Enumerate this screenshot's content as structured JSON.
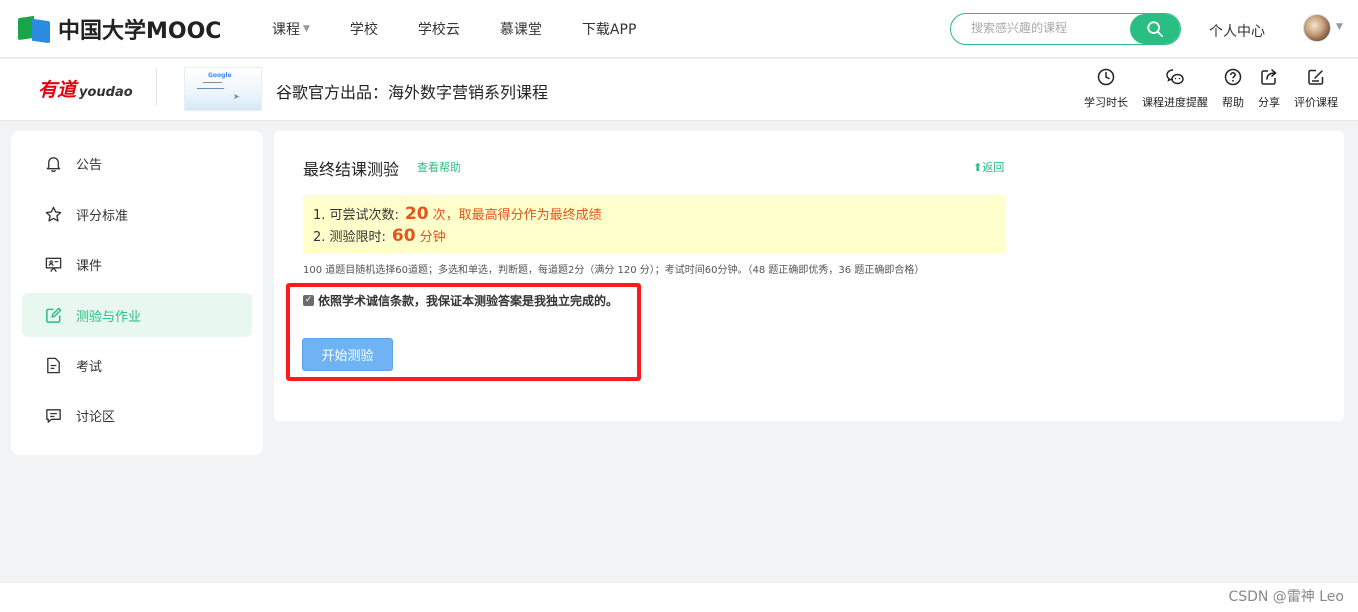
{
  "brand": {
    "logo_text": "中国大学MOOC"
  },
  "nav": {
    "items": [
      {
        "label": "课程",
        "has_caret": true
      },
      {
        "label": "学校"
      },
      {
        "label": "学校云"
      },
      {
        "label": "慕课堂"
      },
      {
        "label": "下载APP"
      }
    ],
    "search_placeholder": "搜索感兴趣的课程",
    "personal_center": "个人中心"
  },
  "course": {
    "partner_logo_cn": "有道",
    "partner_logo_en": "youdao",
    "thumb_brand": "Google",
    "title": "谷歌官方出品：海外数字营销系列课程",
    "tools": [
      {
        "label": "学习时长",
        "icon": "clock-icon"
      },
      {
        "label": "课程进度提醒",
        "icon": "wechat-icon"
      },
      {
        "label": "帮助",
        "icon": "help-icon"
      },
      {
        "label": "分享",
        "icon": "share-icon"
      },
      {
        "label": "评价课程",
        "icon": "review-icon"
      }
    ]
  },
  "sidebar": {
    "items": [
      {
        "label": "公告",
        "icon": "bell-icon"
      },
      {
        "label": "评分标准",
        "icon": "star-icon"
      },
      {
        "label": "课件",
        "icon": "courseware-icon"
      },
      {
        "label": "测验与作业",
        "icon": "edit-icon",
        "active": true
      },
      {
        "label": "考试",
        "icon": "document-icon"
      },
      {
        "label": "讨论区",
        "icon": "chat-icon"
      }
    ]
  },
  "quiz": {
    "title": "最终结课测验",
    "help_link": "查看帮助",
    "back_link": "返回",
    "attempts_label": "1. 可尝试次数:",
    "attempts_value": "20",
    "attempts_suffix": "次，取最高得分作为最终成绩",
    "time_label": "2. 测验限时:",
    "time_value": "60",
    "time_suffix": "分钟",
    "description": "100 道题目随机选择60道题；多选和单选，判断题，每道题2分（满分 120 分）；考试时间60分钟。（48 题正确即优秀，36 题正确即合格）",
    "pledge": "依照学术诚信条款，我保证本测验答案是我独立完成的。",
    "pledge_checked": true,
    "start_button": "开始测验"
  },
  "colors": {
    "accent": "#2bbe82",
    "highlight": "#e7541a",
    "annotation": "#ff1b1b"
  },
  "watermark": "CSDN @雷神 Leo"
}
